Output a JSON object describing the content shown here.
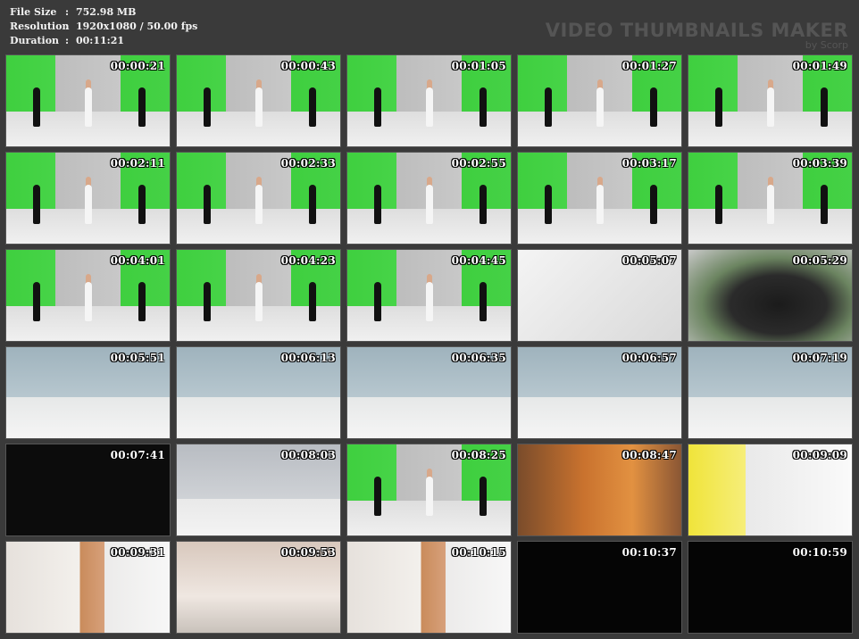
{
  "info": {
    "rows": [
      {
        "label": "File Size",
        "sep": ":",
        "value": "752.98 MB"
      },
      {
        "label": "Resolution",
        "sep": ":",
        "value": "1920x1080 / 50.00 fps"
      },
      {
        "label": "Duration",
        "sep": ":",
        "value": "00:11:21"
      }
    ]
  },
  "brand": {
    "title": "VIDEO THUMBNAILS MAKER",
    "subtitle": "by Scorp"
  },
  "thumbnails": [
    {
      "time": "00:00:21",
      "scene": "green"
    },
    {
      "time": "00:00:43",
      "scene": "green"
    },
    {
      "time": "00:01:05",
      "scene": "green"
    },
    {
      "time": "00:01:27",
      "scene": "green"
    },
    {
      "time": "00:01:49",
      "scene": "green"
    },
    {
      "time": "00:02:11",
      "scene": "green"
    },
    {
      "time": "00:02:33",
      "scene": "green"
    },
    {
      "time": "00:02:55",
      "scene": "green"
    },
    {
      "time": "00:03:17",
      "scene": "green"
    },
    {
      "time": "00:03:39",
      "scene": "green"
    },
    {
      "time": "00:04:01",
      "scene": "green"
    },
    {
      "time": "00:04:23",
      "scene": "green"
    },
    {
      "time": "00:04:45",
      "scene": "green"
    },
    {
      "time": "00:05:07",
      "scene": "white"
    },
    {
      "time": "00:05:29",
      "scene": "face"
    },
    {
      "time": "00:05:51",
      "scene": "studio"
    },
    {
      "time": "00:06:13",
      "scene": "studio"
    },
    {
      "time": "00:06:35",
      "scene": "studio"
    },
    {
      "time": "00:06:57",
      "scene": "studio"
    },
    {
      "time": "00:07:19",
      "scene": "studio"
    },
    {
      "time": "00:07:41",
      "scene": "dark"
    },
    {
      "time": "00:08:03",
      "scene": "room"
    },
    {
      "time": "00:08:25",
      "scene": "green"
    },
    {
      "time": "00:08:47",
      "scene": "orange"
    },
    {
      "time": "00:09:09",
      "scene": "yellow"
    },
    {
      "time": "00:09:31",
      "scene": "stairs"
    },
    {
      "time": "00:09:53",
      "scene": "legs"
    },
    {
      "time": "00:10:15",
      "scene": "stairs"
    },
    {
      "time": "00:10:37",
      "scene": "black"
    },
    {
      "time": "00:10:59",
      "scene": "black"
    }
  ]
}
